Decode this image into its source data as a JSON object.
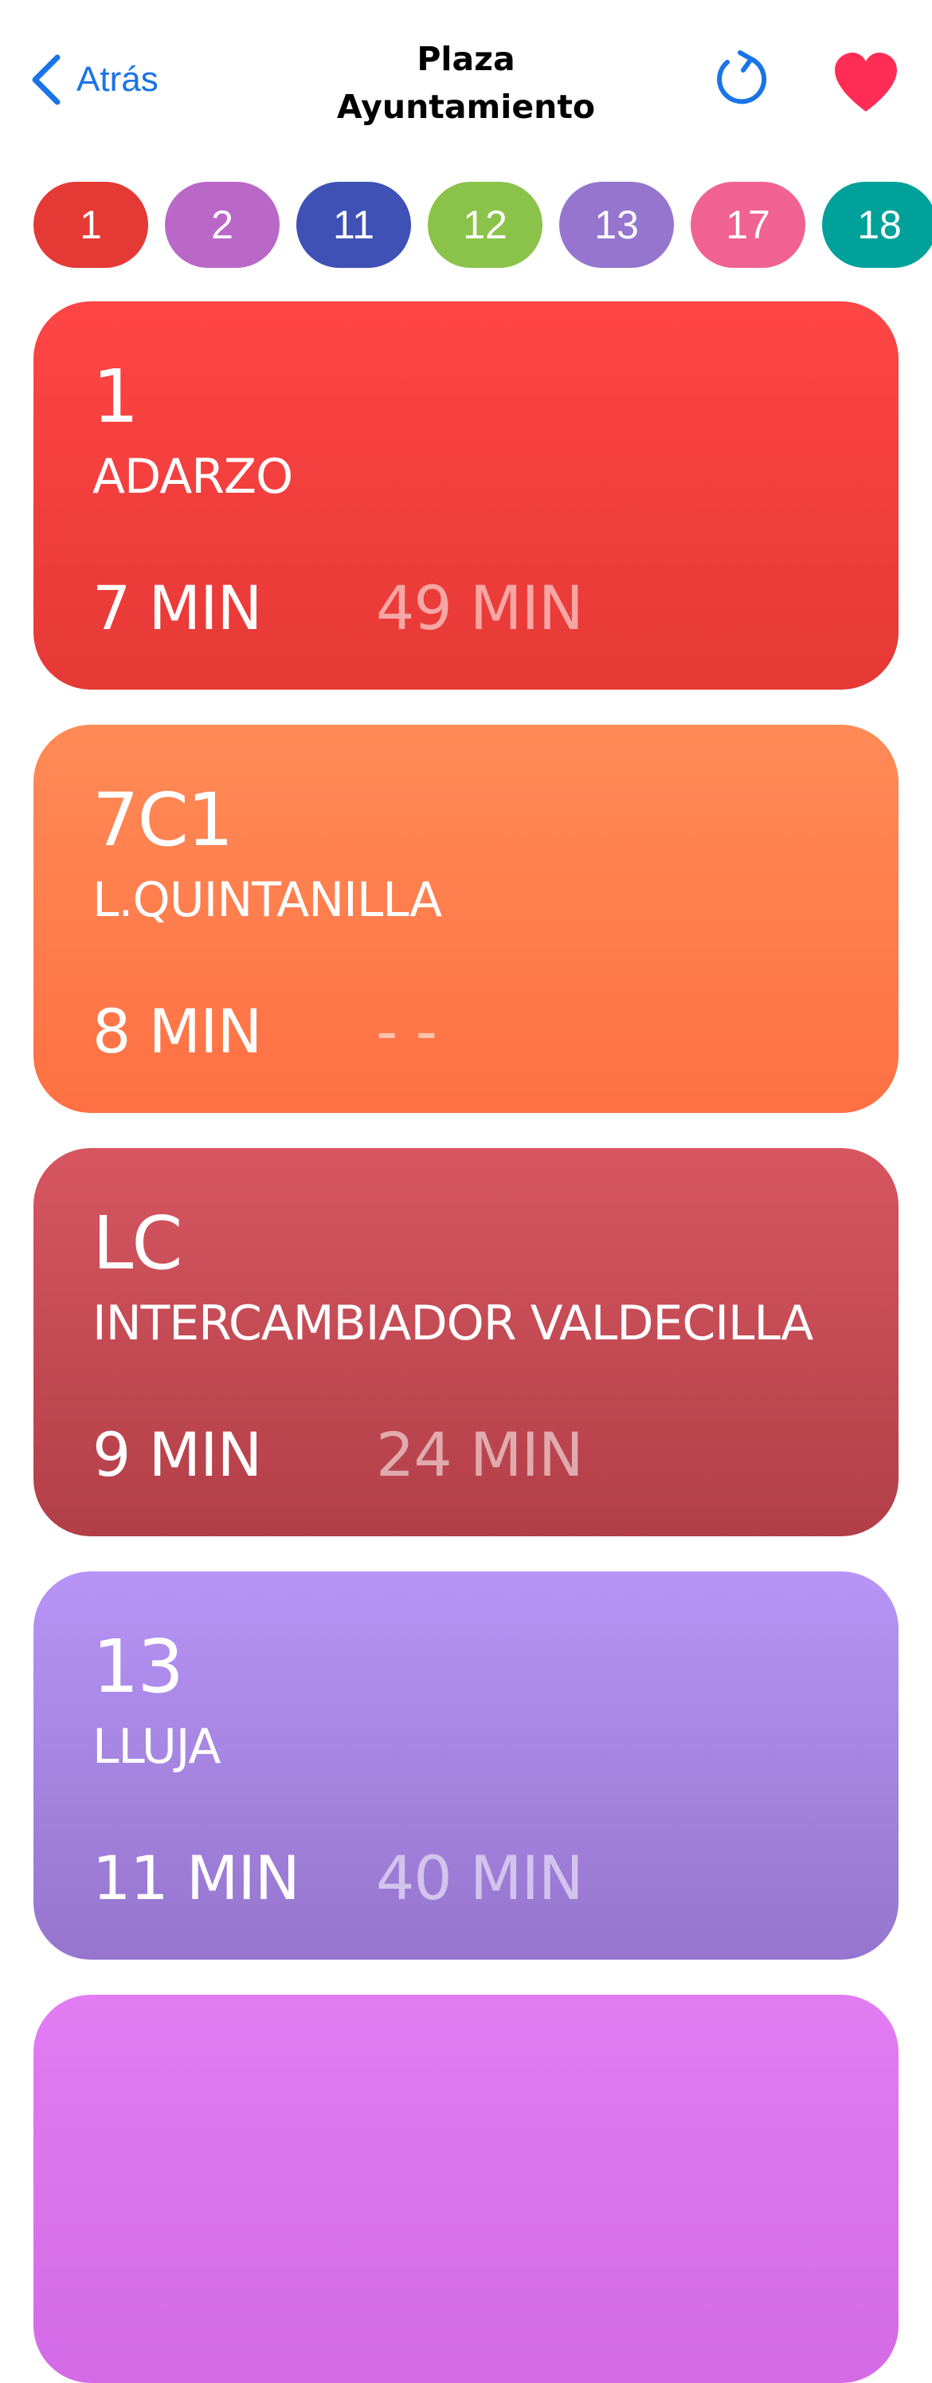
{
  "header": {
    "back_label": "Atrás",
    "title_line1": "Plaza",
    "title_line2": "Ayuntamiento",
    "accent_color": "#1a73e8",
    "favorite_color": "#ff2d55",
    "back_icon": "chevron-left-icon",
    "refresh_icon": "refresh-icon",
    "favorite_icon": "heart-icon"
  },
  "line_chips": [
    {
      "label": "1",
      "color": "#e53935"
    },
    {
      "label": "2",
      "color": "#ba68c8"
    },
    {
      "label": "11",
      "color": "#3f51b5"
    },
    {
      "label": "12",
      "color": "#8bc34a"
    },
    {
      "label": "13",
      "color": "#9575cd"
    },
    {
      "label": "17",
      "color": "#f06292"
    },
    {
      "label": "18",
      "color": "#00a19a"
    }
  ],
  "arrivals": [
    {
      "line": "1",
      "destination": "ADARZO",
      "next": "7 MIN",
      "following": "49 MIN",
      "color_top": "#ff4545",
      "color_bottom": "#e53935"
    },
    {
      "line": "7C1",
      "destination": "L.QUINTANILLA",
      "next": "8 MIN",
      "following": "- -",
      "color_top": "#ff8b57",
      "color_bottom": "#ff7043"
    },
    {
      "line": "LC",
      "destination": "INTERCAMBIADOR VALDECILLA",
      "next": "9 MIN",
      "following": "24 MIN",
      "color_top": "#d65660",
      "color_bottom": "#b23f48"
    },
    {
      "line": "13",
      "destination": "LLUJA",
      "next": "11 MIN",
      "following": "40 MIN",
      "color_top": "#b794f6",
      "color_bottom": "#9575cd"
    },
    {
      "line": "",
      "destination": "",
      "next": "",
      "following": "",
      "color_top": "#e27cf3",
      "color_bottom": "#d46ae6"
    }
  ]
}
